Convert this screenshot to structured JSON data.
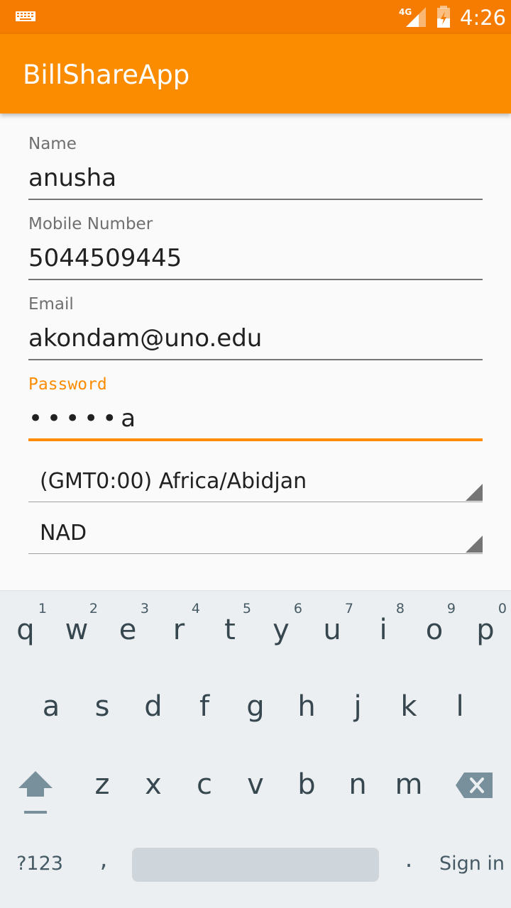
{
  "status_bar": {
    "time": "4:26",
    "network": "4G",
    "icons": [
      "keyboard-notification-icon",
      "signal-4g-icon",
      "battery-icon"
    ]
  },
  "app_bar": {
    "title": "BillShareApp"
  },
  "form": {
    "name": {
      "label": "Name",
      "value": "anusha"
    },
    "mobile": {
      "label": "Mobile Number",
      "value": "5044509445"
    },
    "email": {
      "label": "Email",
      "value": "akondam@uno.edu"
    },
    "password": {
      "label": "Password",
      "value": "•••••a",
      "focused": true
    },
    "timezone": {
      "selected": "(GMT0:00) Africa/Abidjan"
    },
    "currency": {
      "selected": "NAD"
    }
  },
  "keyboard": {
    "row1": [
      {
        "letter": "q",
        "hint": "1"
      },
      {
        "letter": "w",
        "hint": "2"
      },
      {
        "letter": "e",
        "hint": "3"
      },
      {
        "letter": "r",
        "hint": "4"
      },
      {
        "letter": "t",
        "hint": "5"
      },
      {
        "letter": "y",
        "hint": "6"
      },
      {
        "letter": "u",
        "hint": "7"
      },
      {
        "letter": "i",
        "hint": "8"
      },
      {
        "letter": "o",
        "hint": "9"
      },
      {
        "letter": "p",
        "hint": "0"
      }
    ],
    "row2": [
      "a",
      "s",
      "d",
      "f",
      "g",
      "h",
      "j",
      "k",
      "l"
    ],
    "row3": [
      "z",
      "x",
      "c",
      "v",
      "b",
      "n",
      "m"
    ],
    "symbols_label": "?123",
    "comma": ",",
    "period": ".",
    "action_label": "Sign in"
  },
  "colors": {
    "status_bar": "#f57c00",
    "app_bar": "#fb8c00",
    "accent": "#fb8c00",
    "keyboard_bg": "#eceff1"
  }
}
